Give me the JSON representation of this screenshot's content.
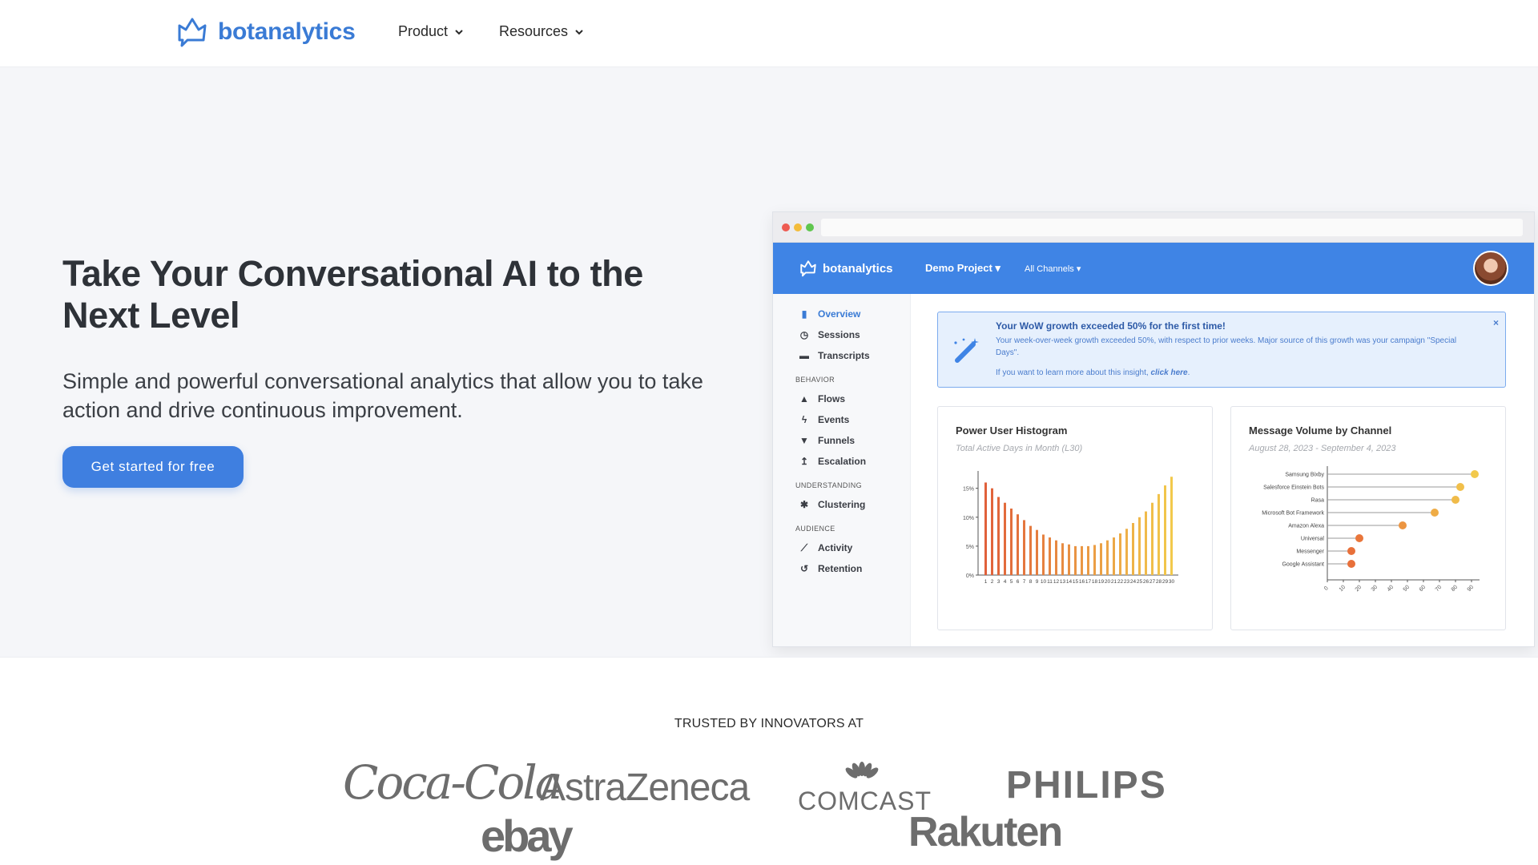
{
  "nav": {
    "brand": "botanalytics",
    "items": [
      {
        "label": "Product"
      },
      {
        "label": "Resources"
      }
    ]
  },
  "hero": {
    "title": "Take Your Conversational AI to the Next Level",
    "subtitle": "Simple and powerful conversational analytics that allow you to take action and drive continuous improvement.",
    "cta": "Get started for free"
  },
  "mockup": {
    "brand": "botanalytics",
    "project": "Demo Project ▾",
    "channels": "All Channels ▾",
    "sidebar": {
      "overview": "Overview",
      "sessions": "Sessions",
      "transcripts": "Transcripts",
      "behavior_head": "BEHAVIOR",
      "flows": "Flows",
      "events": "Events",
      "funnels": "Funnels",
      "escalation": "Escalation",
      "understanding_head": "UNDERSTANDING",
      "clustering": "Clustering",
      "audience_head": "AUDIENCE",
      "activity": "Activity",
      "retention": "Retention"
    },
    "insight": {
      "title": "Your WoW growth exceeded 50% for the first time!",
      "body": "Your week-over-week growth exceeded 50%, with respect to prior weeks. Major source of this growth was your campaign \"Special Days\".",
      "foot_prefix": "If you want to learn more about this insight,",
      "foot_link": "click here",
      "foot_suffix": ".",
      "close": "×"
    },
    "histogram_card": {
      "title": "Power User Histogram",
      "subtitle": "Total Active Days in Month (L30)"
    },
    "channel_card": {
      "title": "Message Volume by Channel",
      "subtitle": "August 28, 2023 - September 4, 2023"
    }
  },
  "chart_data": [
    {
      "type": "bar",
      "title": "Power User Histogram",
      "subtitle": "Total Active Days in Month (L30)",
      "categories": [
        "1",
        "2",
        "3",
        "4",
        "5",
        "6",
        "7",
        "8",
        "9",
        "10",
        "11",
        "12",
        "13",
        "14",
        "15",
        "16",
        "17",
        "18",
        "19",
        "20",
        "21",
        "22",
        "23",
        "24",
        "25",
        "26",
        "27",
        "28",
        "29",
        "30"
      ],
      "values": [
        16,
        15,
        13.5,
        12.5,
        11.5,
        10.5,
        9.5,
        8.5,
        7.8,
        7,
        6.5,
        6,
        5.5,
        5.3,
        5,
        5,
        5,
        5.2,
        5.5,
        6,
        6.5,
        7.2,
        8,
        9,
        10,
        11,
        12.5,
        14,
        15.5,
        17
      ],
      "yticks": [
        "0%",
        "5%",
        "10%",
        "15%"
      ],
      "ylim": [
        0,
        18
      ],
      "colors": {
        "low": "#e0603a",
        "high": "#f2c94c"
      }
    },
    {
      "type": "scatter",
      "title": "Message Volume by Channel",
      "subtitle": "August 28, 2023 - September 4, 2023",
      "categories": [
        "Samsung Bixby",
        "Salesforce Einstein Bots",
        "Rasa",
        "Microsoft Bot Framework",
        "Amazon Alexa",
        "Universal",
        "Messenger",
        "Google Assistant"
      ],
      "values": [
        92,
        83,
        80,
        67,
        47,
        20,
        15,
        15
      ],
      "xticks": [
        "0",
        "10",
        "20",
        "30",
        "40",
        "50",
        "60",
        "70",
        "80",
        "90"
      ],
      "xlim": [
        0,
        95
      ],
      "colors": {
        "high": "#e8703a",
        "low": "#f2c94c"
      }
    }
  ],
  "trusted": {
    "label": "TRUSTED BY INNOVATORS AT",
    "logos": {
      "cocacola": "Coca-Cola",
      "astrazeneca": "AstraZeneca",
      "comcast": "COMCAST",
      "philips": "PHILIPS",
      "ebay": "ebay",
      "rakuten": "Rakuten"
    }
  }
}
